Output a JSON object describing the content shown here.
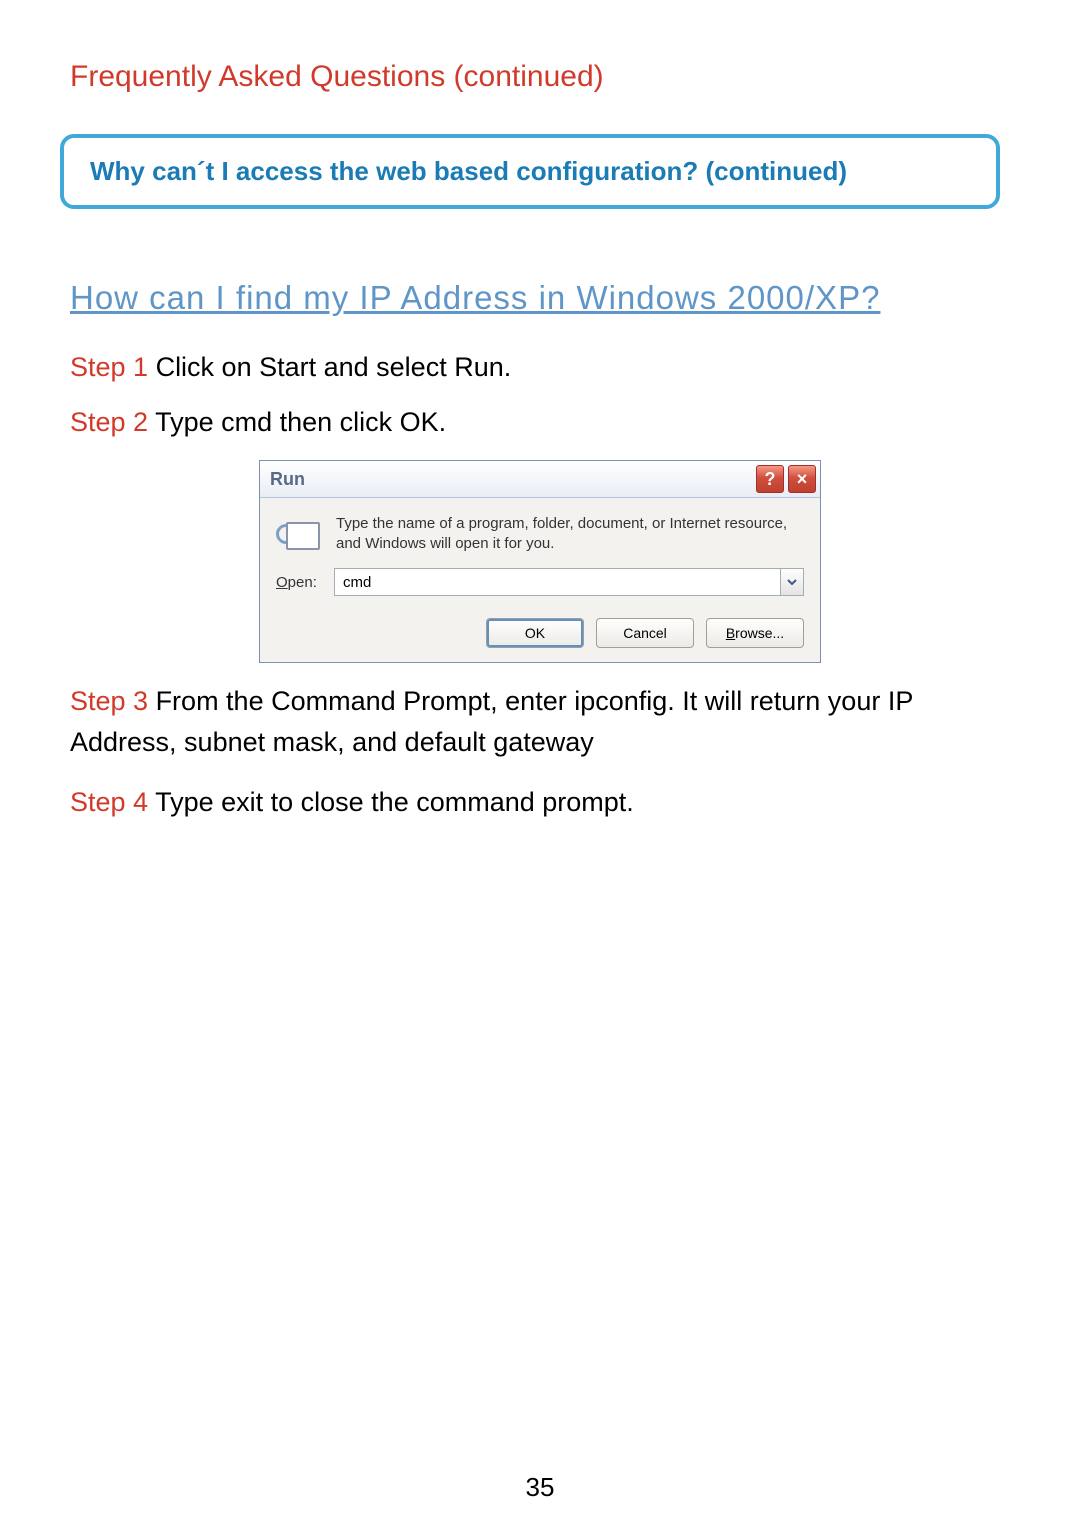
{
  "header": {
    "title": "Frequently Asked Questions (continued)"
  },
  "banner": {
    "text": "Why can´t I access the web based configuration? (continued)"
  },
  "section": {
    "heading": "How can I find my IP Address in Windows 2000/XP?"
  },
  "steps": {
    "s1_label": "Step 1",
    "s1_text": " Click on Start and select Run.",
    "s2_label": "Step 2",
    "s2_text": " Type cmd then click OK.",
    "s3_label": "Step 3",
    "s3_text": " From the Command Prompt, enter ipconfig. It will return your IP Address, subnet mask, and default gateway",
    "s4_label": "Step 4",
    "s4_text": " Type exit to close the command prompt."
  },
  "dialog": {
    "title": "Run",
    "help_glyph": "?",
    "close_glyph": "×",
    "description": "Type the name of a program, folder, document, or Internet resource, and Windows will open it for you.",
    "open_label_u": "O",
    "open_label_rest": "pen:",
    "input_value": "cmd",
    "ok": "OK",
    "cancel": "Cancel",
    "browse_u": "B",
    "browse_rest": "rowse..."
  },
  "page_number": "35"
}
